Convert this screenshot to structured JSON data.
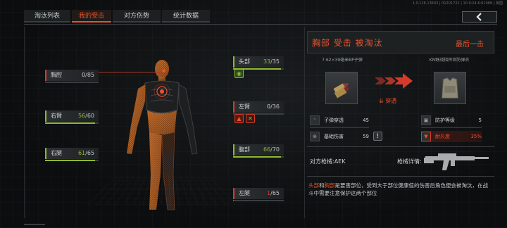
{
  "meta": {
    "version_text": "1.0.126.13603 | 01201722 | 10.0:24:6:61988 | 英国"
  },
  "tabs": [
    {
      "label": "淘汰列表",
      "active": false
    },
    {
      "label": "我的受击",
      "active": true
    },
    {
      "label": "对方伤势",
      "active": false
    },
    {
      "label": "统计数据",
      "active": false
    }
  ],
  "body_parts": {
    "thorax": {
      "label": "胸腔",
      "current": "0",
      "max": "/85",
      "fill": 0.0
    },
    "right_arm": {
      "label": "右臂",
      "current": "56",
      "max": "/60",
      "fill": 0.93
    },
    "right_leg": {
      "label": "右腿",
      "current": "61",
      "max": "/65",
      "fill": 0.94
    },
    "head": {
      "label": "头部",
      "current": "33",
      "max": "/35",
      "fill": 0.94
    },
    "left_arm": {
      "label": "左臂",
      "current": "0",
      "max": "/36",
      "fill": 0.0
    },
    "stomach": {
      "label": "腹部",
      "current": "66",
      "max": "/70",
      "fill": 0.94
    },
    "left_leg": {
      "label": "左腿",
      "current": "1",
      "max": "/65",
      "fill": 0.02
    }
  },
  "colors": {
    "accent": "#e8522e",
    "health_green": "#8fb834",
    "health_red": "#d63a2a",
    "body_orange": "#d87a34"
  },
  "hit_panel": {
    "title": "胸部 受击 被淘汰",
    "last_hit": "最后一击",
    "ammo_name": "7.62×39毫米BP子弹",
    "armor_name": "KN野战指挥官防弹衣",
    "penetration": "穿透",
    "stats_left": [
      {
        "icon": "bullet-icon",
        "label": "子弹穿透",
        "value": "45"
      },
      {
        "icon": "crosshair-icon",
        "label": "基础伤害",
        "value": "59"
      }
    ],
    "stats_right": [
      {
        "icon": "vest-icon",
        "label": "防护等级",
        "value": "5"
      },
      {
        "icon": "durability-icon",
        "label": "耐久度",
        "value": "35%"
      }
    ],
    "enemy_weapon_label": "对方枪械:AEK",
    "weapon_detail_label": "枪械详情:",
    "description_hl1": "头部",
    "description_and": "和",
    "description_hl2": "胸部",
    "description_rest": "是要害部位，受到大于部位健康值的伤害后角色便会被淘汰，在战斗中需要注意保护这两个部位"
  }
}
